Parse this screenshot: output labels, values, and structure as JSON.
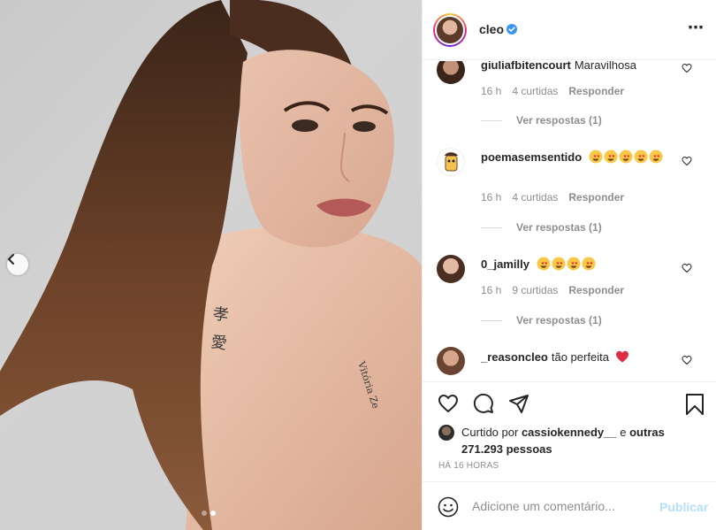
{
  "post": {
    "carousel": {
      "dots": 2,
      "active_index": 1
    }
  },
  "header": {
    "username": "cleo",
    "more_icon": "⋯"
  },
  "comments": [
    {
      "user": "giuliafbitencourt",
      "text": "Maravilhosa",
      "time": "16 h",
      "likes": "4 curtidas",
      "reply": "Responder",
      "replies": "Ver respostas (1)",
      "emojis": []
    },
    {
      "user": "poemasemsentido",
      "text": "",
      "time": "16 h",
      "likes": "4 curtidas",
      "reply": "Responder",
      "replies": "Ver respostas (1)",
      "emojis": [
        "star-struck",
        "star-struck",
        "star-struck",
        "star-struck",
        "star-struck"
      ]
    },
    {
      "user": "0_jamilly",
      "text": "",
      "time": "16 h",
      "likes": "9 curtidas",
      "reply": "Responder",
      "replies": "Ver respostas (1)",
      "emojis": [
        "star-struck",
        "star-struck",
        "star-struck",
        "star-struck"
      ]
    },
    {
      "user": "_reasoncleo",
      "text": "tão perfeita",
      "emojis": [
        "red-heart"
      ]
    }
  ],
  "likes": {
    "prefix": "Curtido por",
    "user": "cassiokennedy__",
    "connector": "e",
    "others": "outras 271.293 pessoas"
  },
  "timestamp": "HÁ 16 HORAS",
  "add_comment": {
    "placeholder": "Adicione um comentário...",
    "publish_label": "Publicar"
  },
  "colors": {
    "verified": "#3897f0",
    "publish_disabled": "#b2dffc",
    "meta_text": "#8e8e8e",
    "heart_red": "#ed4956"
  }
}
